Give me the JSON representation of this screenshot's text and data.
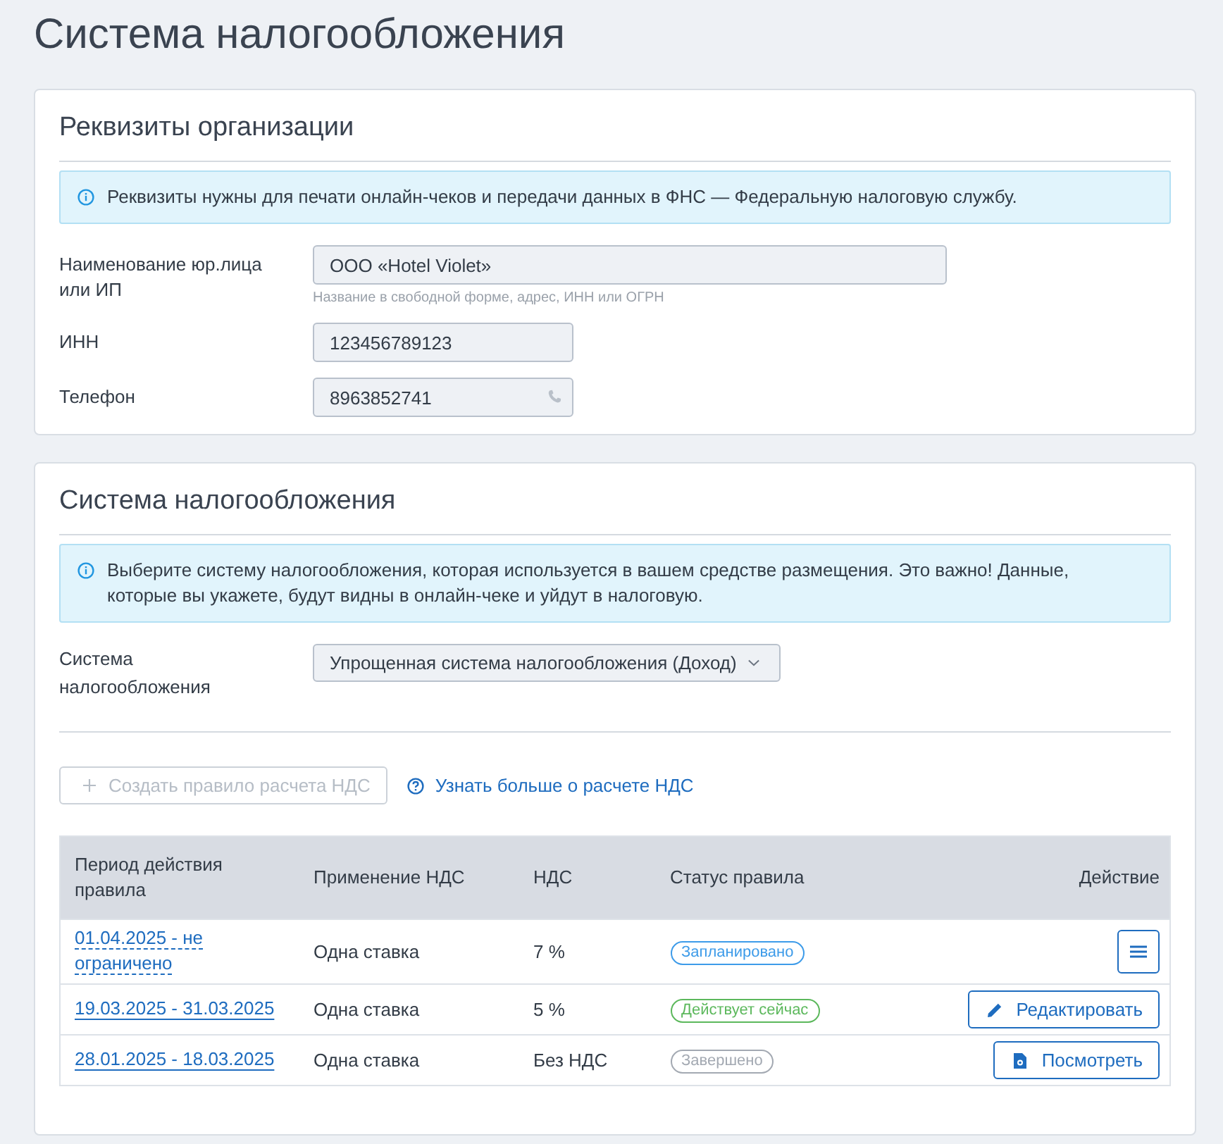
{
  "page_title": "Система налогообложения",
  "organization": {
    "title": "Реквизиты организации",
    "notice": "Реквизиты нужны для печати онлайн-чеков и передачи данных в ФНС — Федеральную налоговую службу.",
    "fields": [
      {
        "kind": "long",
        "label": "Наименование юр.лица или ИП",
        "value": "ООО «Hotel Violet»",
        "hint": "Название в свободной форме, адрес, ИНН или ОГРН"
      },
      {
        "kind": "short",
        "label": "ИНН",
        "value": "123456789123"
      },
      {
        "kind": "phone",
        "label": "Телефон",
        "value": "8963852741"
      }
    ]
  },
  "tax": {
    "title": "Система налогообложения",
    "notice": "Выберите систему налогообложения, которая используется в вашем средстве размещения. Это важно! Данные, которые вы укажете, будут видны в онлайн-чеке и уйдут в налоговую.",
    "select": {
      "label": "Система налогообложения",
      "value": "Упрощенная система налогообложения (Доход)"
    },
    "create_button": {
      "label": "Создать правило расчета НДС",
      "disabled": true
    },
    "help_link": "Узнать больше о расчете НДС",
    "table": {
      "columns": [
        "Период действия правила",
        "Применение НДС",
        "НДС",
        "Статус правила",
        "Действие"
      ],
      "rows": [
        {
          "period": "01.04.2025 - не ограничено",
          "dashed": true,
          "application": "Одна ставка",
          "vat": "7 %",
          "status": {
            "label": "Запланировано",
            "color": "#3d9be9"
          },
          "action": {
            "kind": "menu"
          }
        },
        {
          "period": "19.03.2025 - 31.03.2025",
          "dashed": false,
          "application": "Одна ставка",
          "vat": "5 %",
          "status": {
            "label": "Действует сейчас",
            "color": "#5cb85c"
          },
          "action": {
            "kind": "edit",
            "label": "Редактировать"
          }
        },
        {
          "period": "28.01.2025 - 18.03.2025",
          "dashed": false,
          "application": "Одна ставка",
          "vat": "Без НДС",
          "status": {
            "label": "Завершено",
            "color": "#a3a9b2"
          },
          "action": {
            "kind": "view",
            "label": "Посмотреть"
          }
        }
      ]
    }
  }
}
